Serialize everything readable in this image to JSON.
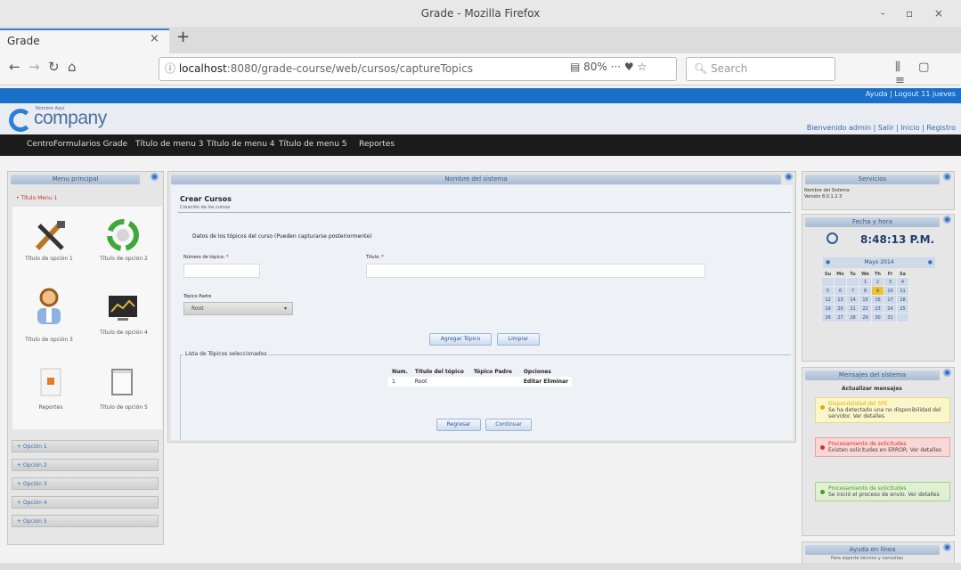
{
  "browser": {
    "window_title": "Grade - Mozilla Firefox",
    "tab_label": "Grade",
    "tab_close": "×",
    "new_tab": "+",
    "url_host": "localhost",
    "url_path": ":8080/grade-course/web/cursos/captureTopics",
    "zoom": "80%",
    "search_placeholder": "Search",
    "page_actions": "···  ♥  ☆",
    "toolbar_icons": "⫼ ▢ ≡",
    "window_controls": "-  ▫  ×"
  },
  "app": {
    "top_link": "Ayuda | Logout 11 jueves",
    "logo_small": "Nombre Aquí",
    "logo_text": "company",
    "user_links": "Bienvenido admin | Salir | Inicio | Registro",
    "menu": [
      "Centro",
      "Formularios Grade",
      "Título de menu 3",
      "Título de menu 4",
      "Título de menu 5",
      "Reportes"
    ],
    "accent": "#1a6fc9"
  },
  "left": {
    "header": "Menu principal",
    "title": "• Título Menu 1",
    "icons": [
      {
        "label": "Título de opción 1",
        "icon": "tools-icon"
      },
      {
        "label": "Título de opción 2",
        "icon": "recycle-icon"
      },
      {
        "label": "Título de opción 3",
        "icon": "user-icon"
      },
      {
        "label": "Título de opción 4",
        "icon": "monitor-icon"
      },
      {
        "label": "Reportes",
        "icon": "document-icon"
      },
      {
        "label": "Título de opción 5",
        "icon": "frame-icon"
      }
    ],
    "options": [
      "+ Opción 1",
      "+ Opción 2",
      "+ Opción 3",
      "+ Opción 4",
      "+ Opción 5"
    ]
  },
  "main": {
    "header": "Nombre del sistema",
    "title": "Crear Cursos",
    "subtitle": "Creación de los cursos",
    "instructions": "Datos de los tópicos del curso (Pueden capturarse posteriormente)",
    "field_num_label": "Número de tópico: *",
    "field_title_label": "Título: *",
    "parent_label": "Tópico Padre",
    "parent_value": "Root",
    "add_button": "Agregar Tópico",
    "clear_button": "Limpiar",
    "legend": "Lista de Tópicos seleccionados",
    "table_headers": [
      "Num.",
      "Título del tópico",
      "Tópico Padre",
      "Opciones"
    ],
    "table_rows": [
      [
        "1",
        "Root",
        "",
        "Editar Eliminar"
      ]
    ],
    "back_button": "Regresar",
    "continue_button": "Continuar"
  },
  "right": {
    "services_header": "Servicios",
    "system_name": "Nombre del Sistema",
    "version": "Versión 8.0.1.2.3",
    "date_header": "Fecha y hora",
    "time": "8:48:13 P.M.",
    "month": "Mayo 2014",
    "weekdays": [
      "Su",
      "Mo",
      "Tu",
      "We",
      "Th",
      "Fr",
      "Sa"
    ],
    "weeks": [
      [
        "",
        "",
        "",
        "1",
        "2",
        "3",
        "4"
      ],
      [
        "5",
        "6",
        "7",
        "8",
        "9",
        "10",
        "11"
      ],
      [
        "12",
        "13",
        "14",
        "15",
        "16",
        "17",
        "18"
      ],
      [
        "19",
        "20",
        "21",
        "22",
        "23",
        "24",
        "25"
      ],
      [
        "26",
        "27",
        "28",
        "29",
        "30",
        "31",
        ""
      ]
    ],
    "messages_header": "Mensajes del sistema",
    "messages_title": "Actualizar mensajes",
    "messages": [
      {
        "title": "Disponibilidad del SPE",
        "body": "Se ha detectado una no disponibilidad del servidor. Ver detalles",
        "bg": "#fbf6c9",
        "border": "#e6d98a",
        "dot": "#e0b000"
      },
      {
        "title": "Procesamiento de solicitudes",
        "body": "Existen solicitudes en ERROR. Ver detalles",
        "bg": "#fad7d7",
        "border": "#e9a3a3",
        "dot": "#d43030"
      },
      {
        "title": "Procesamiento de solicitudes",
        "body": "Se inició el proceso de envío. Ver detalles",
        "bg": "#dff0d3",
        "border": "#a9d08e",
        "dot": "#4e9a2d"
      }
    ],
    "help_header": "Ayuda en línea",
    "help_text": "Para soporte técnico y consultas"
  }
}
